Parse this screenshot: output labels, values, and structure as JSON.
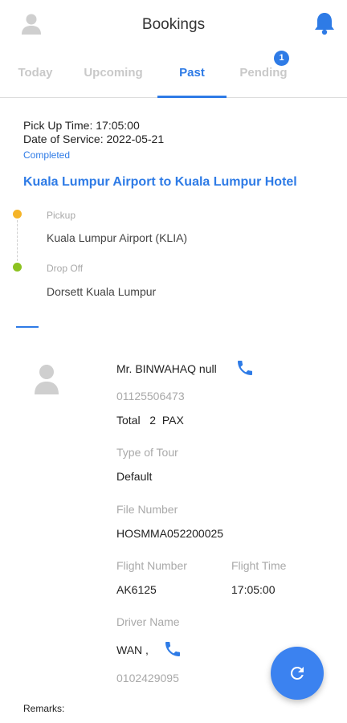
{
  "appbar": {
    "title": "Bookings",
    "avatar_icon": "person-icon",
    "bell_icon": "bell-icon",
    "accent": "#2e7be6"
  },
  "tabs": [
    {
      "label": "Today"
    },
    {
      "label": "Upcoming"
    },
    {
      "label": "Past"
    },
    {
      "label": "Pending",
      "badge": "1"
    }
  ],
  "booking": {
    "pickup_time": "Pick Up Time: 17:05:00",
    "service_date": "Date of Service: 2022-05-21",
    "status": "Completed",
    "route_title": "Kuala Lumpur Airport to Kuala Lumpur Hotel",
    "pickup_label": "Pickup",
    "pickup_location": "Kuala Lumpur Airport (KLIA)",
    "dropoff_label": "Drop Off",
    "dropoff_location": "Dorsett Kuala Lumpur",
    "pickup_color": "#f5b428",
    "dropoff_color": "#8cc220"
  },
  "passenger": {
    "name": "Mr. BINWAHAQ null",
    "phone": "01125506473",
    "total_label": "Total",
    "pax_count": "2",
    "pax_unit": "PAX"
  },
  "details": {
    "type_of_tour_label": "Type of Tour",
    "type_of_tour": "Default",
    "file_number_label": "File Number",
    "file_number": "HOSMMA052200025",
    "flight_number_label": "Flight Number",
    "flight_number": "AK6125",
    "flight_time_label": "Flight Time",
    "flight_time": "17:05:00",
    "driver_name_label": "Driver Name",
    "driver_name": "WAN ,",
    "driver_phone": "0102429095",
    "remarks_label": "Remarks:"
  },
  "fab": {
    "icon": "refresh-icon"
  }
}
